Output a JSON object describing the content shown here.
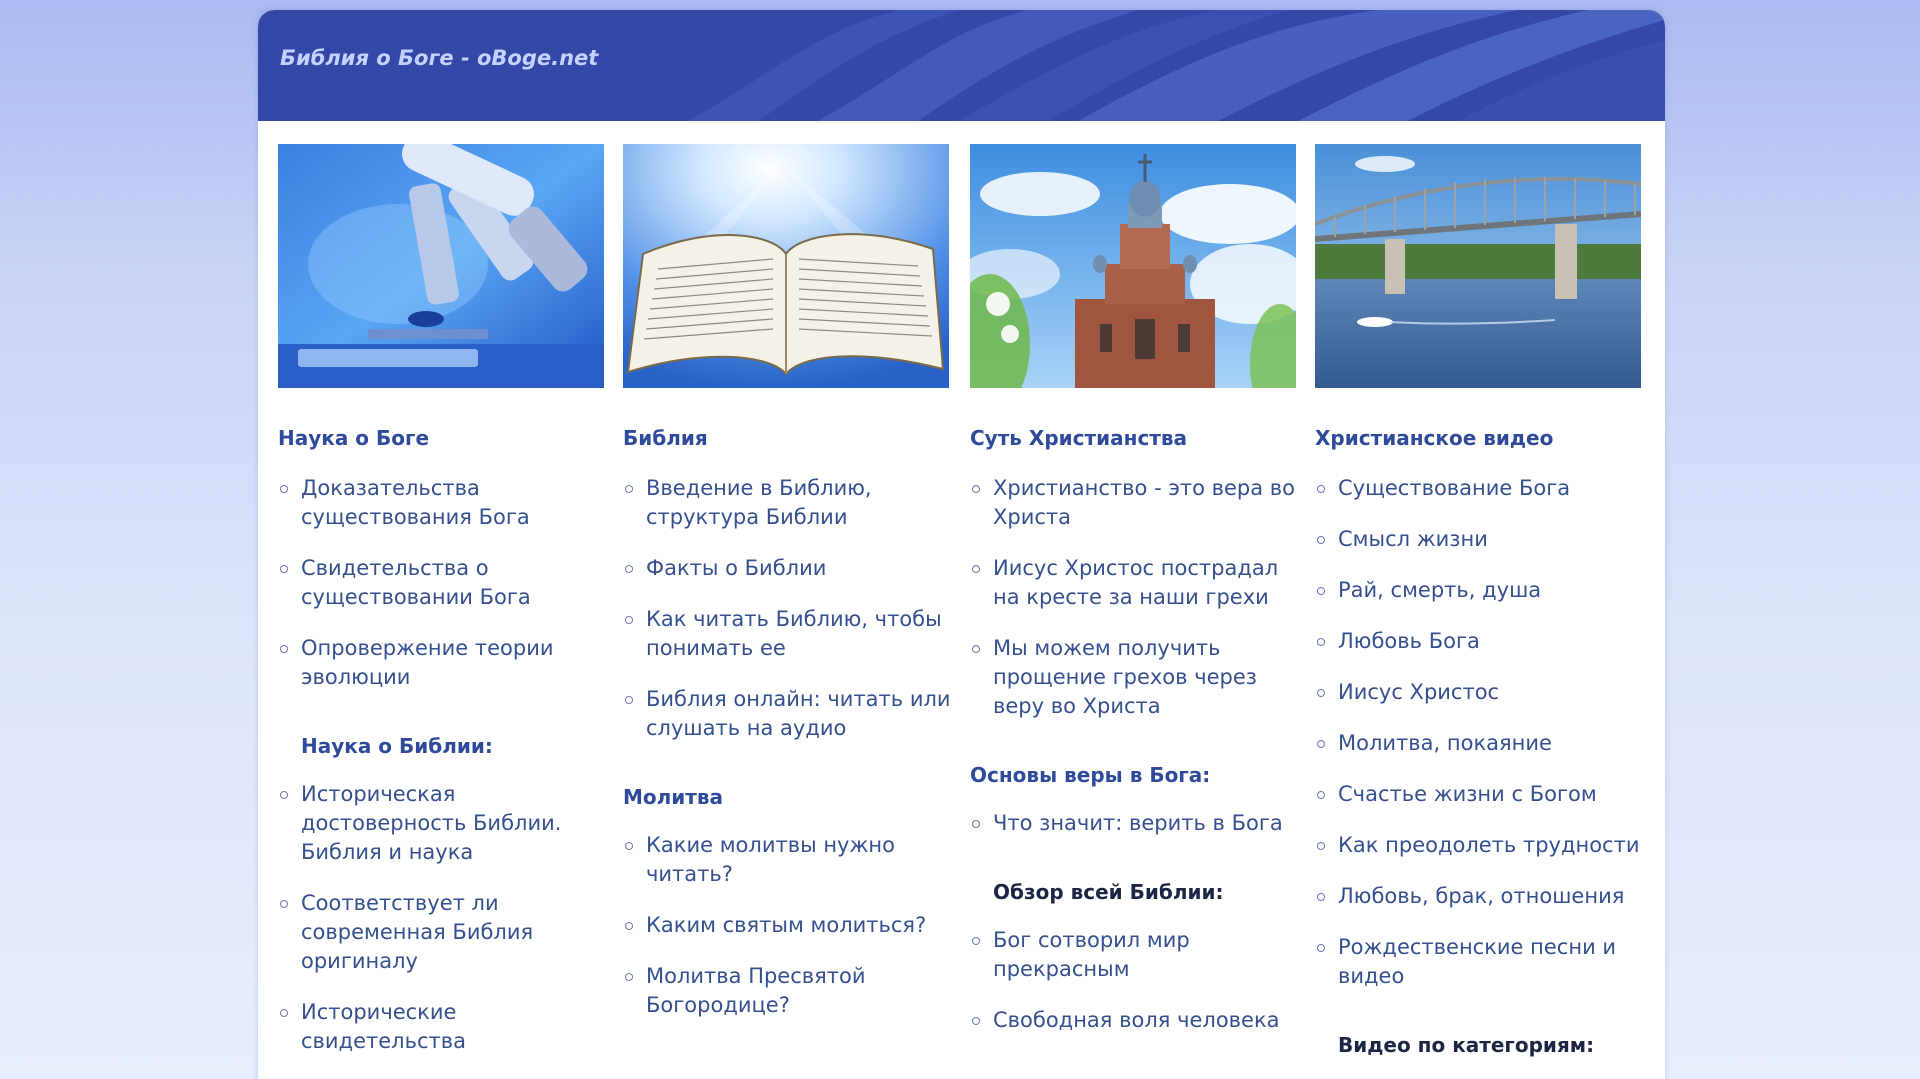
{
  "header": {
    "site_title": "Библия о Боге - oBoge.net"
  },
  "columns": [
    {
      "image": "microscope-image",
      "title": "Наука о Боге",
      "links": [
        "Доказательства существования Бога",
        "Свидетельства о существовании Бога",
        "Опровержение теории эволюции"
      ],
      "subtitle": "Наука о Библии:",
      "sublinks": [
        "Историческая достоверность Библии. Библия и наука",
        "Соответствует ли современная Библия оригиналу",
        "Исторические свидетельства"
      ]
    },
    {
      "image": "bible-image",
      "title": "Библия",
      "links": [
        "Введение в Библию, структура Библии",
        "Факты о Библии",
        "Как читать Библию, чтобы понимать ее",
        "Библия онлайн: читать или слушать на аудио"
      ],
      "section2_title": "Молитва",
      "section2_links": [
        "Какие молитвы нужно читать?",
        "Каким святым молиться?",
        "Молитва Пресвятой Богородице?"
      ]
    },
    {
      "image": "church-image",
      "title": "Суть Христианства",
      "links": [
        "Христианство - это вера во Христа",
        "Иисус Христос пострадал на кресте за наши грехи",
        "Мы можем получить прощение грехов через веру во Христа"
      ],
      "section2_title": "Основы веры в Бога:",
      "section2_links": [
        "Что значит: верить в Бога"
      ],
      "subtitle": "Обзор всей Библии:",
      "sublinks": [
        "Бог сотворил мир прекрасным",
        "Свободная воля человека"
      ]
    },
    {
      "image": "bridge-image",
      "title": "Христианское видео",
      "links": [
        "Существование Бога",
        "Смысл жизни",
        "Рай, смерть, душа",
        "Любовь Бога",
        "Иисус Христос",
        "Молитва, покаяние",
        "Счастье жизни с Богом",
        "Как преодолеть трудности",
        "Любовь, брак, отношения",
        "Рождественские песни и видео"
      ],
      "subtitle": "Видео по категориям:"
    }
  ],
  "colors": {
    "header_bg": "#3448a8",
    "link": "#36508f",
    "heading": "#2f4a9a"
  }
}
